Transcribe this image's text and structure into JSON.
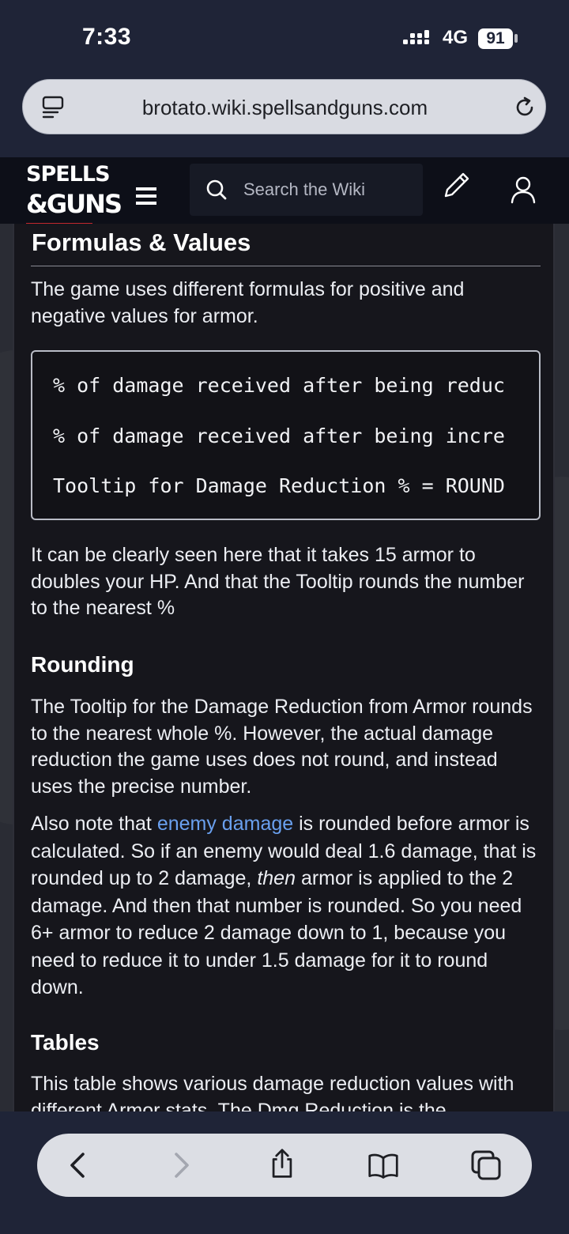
{
  "status_bar": {
    "time": "7:33",
    "network": "4G",
    "battery": "91"
  },
  "browser": {
    "url": "brotato.wiki.spellsandguns.com"
  },
  "site": {
    "logo_line1": "SPELLS",
    "logo_line2": "&GUNS",
    "search_placeholder": "Search the Wiki"
  },
  "article": {
    "section_title": "Formulas & Values",
    "intro": "The game uses different formulas for positive and negative values for armor.",
    "code_lines": [
      "% of damage received after being reduc",
      "% of damage received after being incre",
      "Tooltip for Damage Reduction % = ROUND"
    ],
    "after_code": "It can be clearly seen here that it takes 15 armor to doubles your HP. And that the Tooltip rounds the number to the nearest %",
    "rounding_title": "Rounding",
    "rounding_p1": "The Tooltip for the Damage Reduction from Armor rounds to the nearest whole %. However, the actual damage reduction the game uses does not round, and instead uses the precise number.",
    "rounding_p2_start": "Also note that ",
    "rounding_p2_link": "enemy damage",
    "rounding_p2_mid": " is rounded before armor is calculated. So if an enemy would deal 1.6 damage, that is rounded up to 2 damage, ",
    "rounding_p2_em": "then",
    "rounding_p2_end": " armor is applied to the 2 damage. And then that number is rounded. So you need 6+ armor to reduce 2 damage down to 1, because you need to reduce it to under 1.5 damage for it to round down.",
    "tables_title": "Tables",
    "tables_p": "This table shows various damage reduction values with different Armor stats. The Dmg Reduction is the"
  },
  "toolbar": {
    "icons": [
      "back-icon",
      "forward-icon",
      "share-icon",
      "bookmarks-icon",
      "tabs-icon"
    ]
  }
}
